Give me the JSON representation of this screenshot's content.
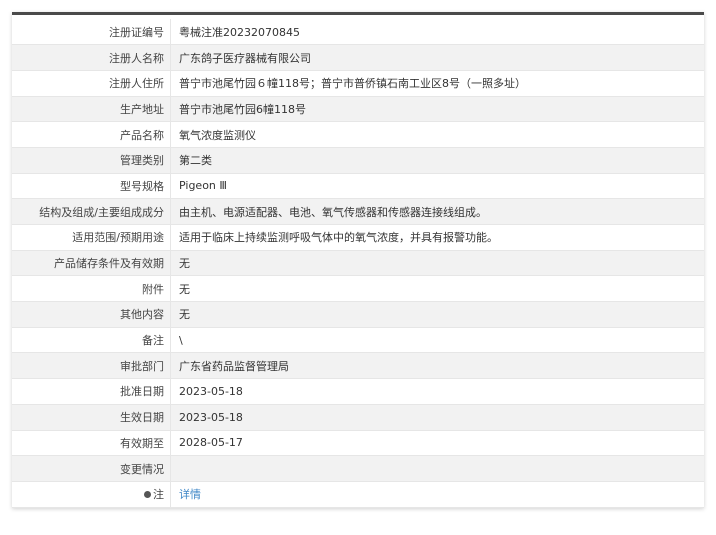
{
  "rows": [
    {
      "label": "注册证编号",
      "value": "粤械注准20232070845"
    },
    {
      "label": "注册人名称",
      "value": "广东鸽子医疗器械有限公司"
    },
    {
      "label": "注册人住所",
      "value": "普宁市池尾竹园６幢118号；普宁市普侨镇石南工业区8号（一照多址）"
    },
    {
      "label": "生产地址",
      "value": "普宁市池尾竹园6幢118号"
    },
    {
      "label": "产品名称",
      "value": "氧气浓度监测仪"
    },
    {
      "label": "管理类别",
      "value": "第二类"
    },
    {
      "label": "型号规格",
      "value": "Pigeon Ⅲ"
    },
    {
      "label": "结构及组成/主要组成成分",
      "value": "由主机、电源适配器、电池、氧气传感器和传感器连接线组成。"
    },
    {
      "label": "适用范围/预期用途",
      "value": "适用于临床上持续监测呼吸气体中的氧气浓度，并具有报警功能。"
    },
    {
      "label": "产品储存条件及有效期",
      "value": "无"
    },
    {
      "label": "附件",
      "value": "无"
    },
    {
      "label": "其他内容",
      "value": "无"
    },
    {
      "label": "备注",
      "value": "\\"
    },
    {
      "label": "审批部门",
      "value": "广东省药品监督管理局"
    },
    {
      "label": "批准日期",
      "value": "2023-05-18"
    },
    {
      "label": "生效日期",
      "value": "2023-05-18"
    },
    {
      "label": "有效期至",
      "value": "2028-05-17"
    },
    {
      "label": "变更情况",
      "value": ""
    }
  ],
  "note_row": {
    "label": "注",
    "link": "详情"
  }
}
